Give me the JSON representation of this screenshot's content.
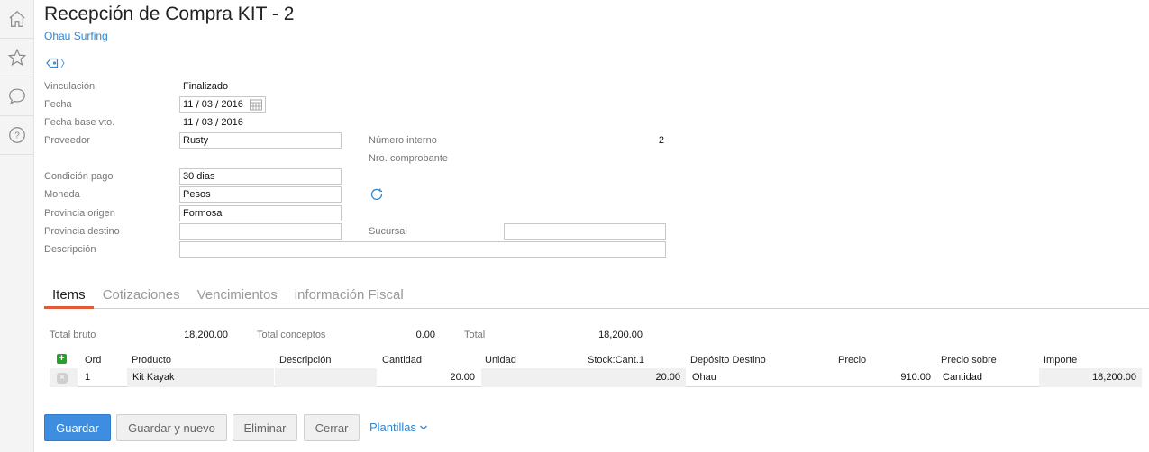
{
  "rail": [
    {
      "icon": "home-icon"
    },
    {
      "icon": "star-icon"
    },
    {
      "icon": "chat-icon"
    },
    {
      "icon": "help-icon",
      "glyph": "?"
    }
  ],
  "header": {
    "title": "Recepción de Compra KIT - 2",
    "subtitle": "Ohau Surfing",
    "tag_chevron": "〉"
  },
  "form": {
    "vinculacion_label": "Vinculación",
    "vinculacion_value": "Finalizado",
    "fecha_label": "Fecha",
    "fecha_day": "11",
    "fecha_month": "03",
    "fecha_year": "2016",
    "fecha_base_label": "Fecha base vto.",
    "fecha_base_day": "11",
    "fecha_base_month": "03",
    "fecha_base_year": "2016",
    "date_sep": "/",
    "proveedor_label": "Proveedor",
    "proveedor_value": "Rusty",
    "numero_interno_label": "Número interno",
    "numero_interno_value": "2",
    "nro_comprobante_label": "Nro. comprobante",
    "condicion_pago_label": "Condición pago",
    "condicion_pago_value": "30 dias",
    "moneda_label": "Moneda",
    "moneda_value": "Pesos",
    "provincia_origen_label": "Provincia origen",
    "provincia_origen_value": "Formosa",
    "provincia_destino_label": "Provincia destino",
    "provincia_destino_value": "",
    "sucursal_label": "Sucursal",
    "sucursal_value": "",
    "descripcion_label": "Descripción",
    "descripcion_value": ""
  },
  "tabs": [
    {
      "label": "Items",
      "active": true
    },
    {
      "label": "Cotizaciones",
      "active": false
    },
    {
      "label": "Vencimientos",
      "active": false
    },
    {
      "label": "información Fiscal",
      "active": false
    }
  ],
  "totals": {
    "bruto_label": "Total bruto",
    "bruto_value": "18,200.00",
    "conceptos_label": "Total conceptos",
    "conceptos_value": "0.00",
    "total_label": "Total",
    "total_value": "18,200.00"
  },
  "grid": {
    "add_glyph": "+",
    "delete_glyph": "×",
    "columns": [
      "Ord",
      "Producto",
      "Descripción",
      "Cantidad",
      "Unidad",
      "Stock:Cant.1",
      "Depósito Destino",
      "Precio",
      "Precio sobre",
      "Importe"
    ],
    "rows": [
      {
        "ord": "1",
        "producto": "Kit Kayak",
        "descripcion": "",
        "cantidad": "20.00",
        "unidad": "",
        "stock": "20.00",
        "deposito": "Ohau",
        "precio": "910.00",
        "precio_sobre": "Cantidad",
        "importe": "18,200.00"
      }
    ]
  },
  "buttons": {
    "guardar": "Guardar",
    "guardar_nuevo": "Guardar y nuevo",
    "eliminar": "Eliminar",
    "cerrar": "Cerrar",
    "plantillas": "Plantillas"
  },
  "colors": {
    "accent": "#2f86d3",
    "primary_button": "#3d8ee0",
    "active_tab_underline": "#e05a3a",
    "add_button": "#25a12b"
  }
}
